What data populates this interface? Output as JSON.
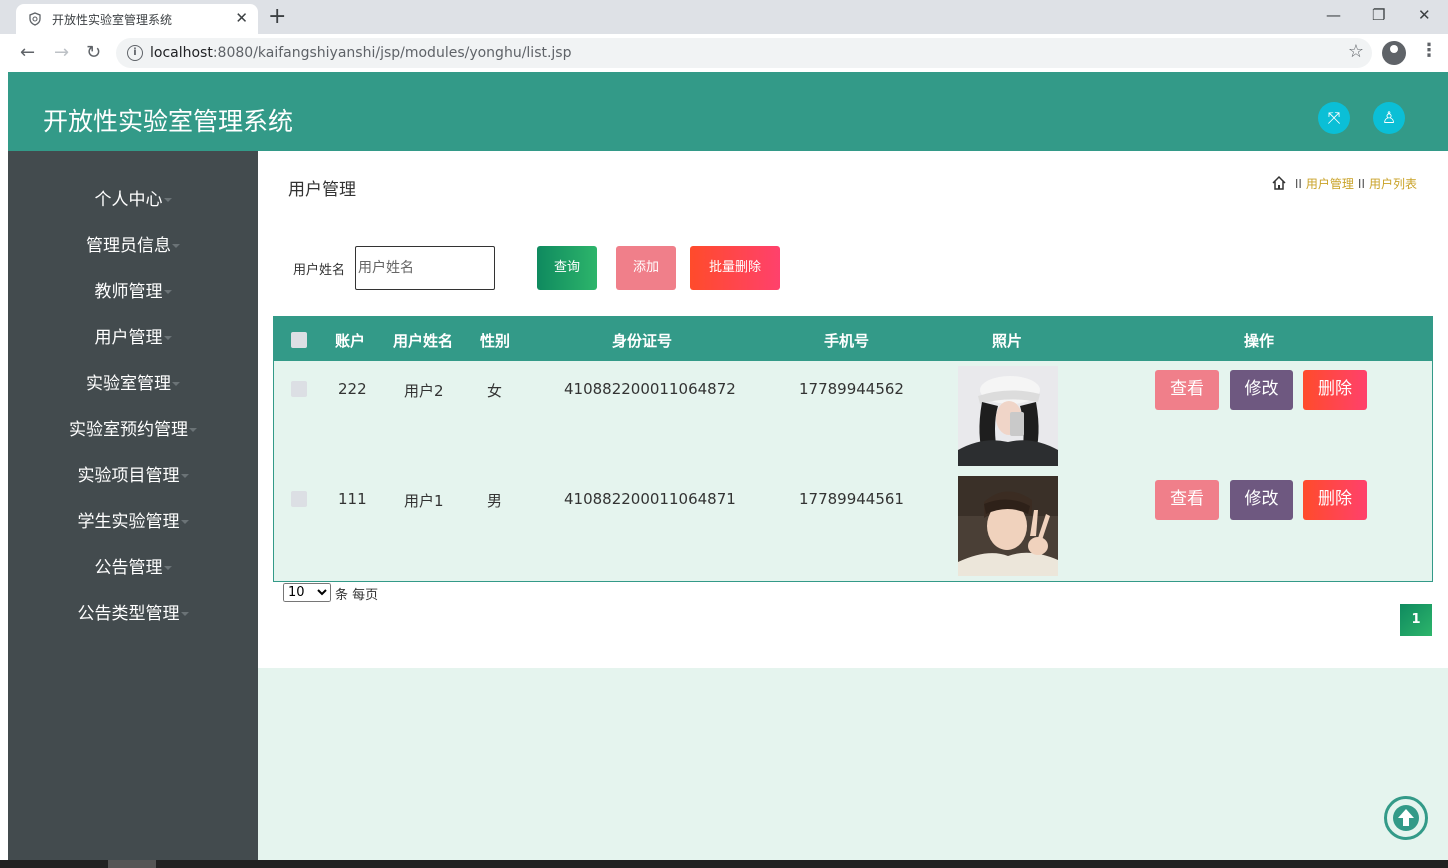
{
  "browser": {
    "tab_title": "开放性实验室管理系统",
    "new_tab": "+",
    "close_tab": "✕",
    "url_host": "localhost",
    "url_rest": ":8080/kaifangshiyanshi/jsp/modules/yonghu/list.jsp",
    "minimize": "—",
    "restore": "❐",
    "close": "✕",
    "back": "←",
    "forward": "→",
    "reload": "↻",
    "star": "☆",
    "info": "i",
    "menu": "⋮"
  },
  "header": {
    "title": "开放性实验室管理系统",
    "fullscreen_icon": "⤧",
    "user_icon": "♙"
  },
  "sidebar": {
    "items": [
      {
        "label": "个人中心"
      },
      {
        "label": "管理员信息"
      },
      {
        "label": "教师管理"
      },
      {
        "label": "用户管理"
      },
      {
        "label": "实验室管理"
      },
      {
        "label": "实验室预约管理"
      },
      {
        "label": "实验项目管理"
      },
      {
        "label": "学生实验管理"
      },
      {
        "label": "公告管理"
      },
      {
        "label": "公告类型管理"
      }
    ]
  },
  "main": {
    "page_title": "用户管理",
    "breadcrumb": {
      "sep": "II",
      "items": [
        "用户管理",
        "用户列表"
      ]
    },
    "search": {
      "label": "用户姓名",
      "placeholder": "用户姓名",
      "value": ""
    },
    "buttons": {
      "query": "查询",
      "add": "添加",
      "batch_delete": "批量删除"
    },
    "table": {
      "headers": [
        "账户",
        "用户姓名",
        "性别",
        "身份证号",
        "手机号",
        "照片",
        "操作"
      ],
      "rows": [
        {
          "account": "222",
          "name": "用户2",
          "gender": "女",
          "id_card": "410882200011064872",
          "phone": "17789944562"
        },
        {
          "account": "111",
          "name": "用户1",
          "gender": "男",
          "id_card": "410882200011064871",
          "phone": "17789944561"
        }
      ],
      "actions": {
        "view": "查看",
        "edit": "修改",
        "delete": "删除"
      }
    },
    "pagination": {
      "page_size": "10",
      "page_size_options": [
        "10"
      ],
      "page_size_suffix": "条 每页",
      "current_page": "1"
    }
  },
  "colors": {
    "primary": "#339a88",
    "sidebar": "#434b4e",
    "content_bg": "#e5f4ee"
  }
}
